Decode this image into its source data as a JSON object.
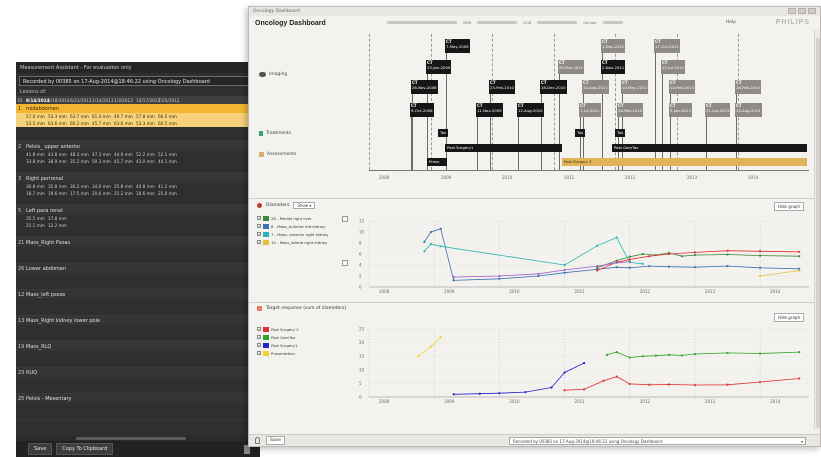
{
  "measurement": {
    "title": "Measurement Assistant - For evaluation only",
    "recorded": "Recorded by 00385 on 17-Aug-2014@18:46:22 using Oncology Dashboard",
    "lesions_of": "Lesions of:",
    "headers": [
      "ID",
      "8/14/2014",
      "2/18/2014",
      "6/21/2013",
      "2/14/2013",
      "1/3/2013",
      "10/17/2012",
      "7/25/2012"
    ],
    "lesions": [
      {
        "num": "1",
        "label": "midabdomen",
        "selected": true,
        "rows": [
          [
            "57.0 mm",
            "53.3 mm",
            "63.7 mm",
            "61.4 mm",
            "49.7 mm",
            "57.8 mm",
            "66.5 mm"
          ],
          [
            "53.5 mm",
            "63.6 mm",
            "60.2 mm",
            "45.7 mm",
            "63.6 mm",
            "53.3 mm",
            "60.5 mm"
          ]
        ]
      },
      {
        "num": "2",
        "label": "Pelvis_ upper anterior",
        "selected": false,
        "rows": [
          [
            "41.8 mm",
            "43.8 mm",
            "48.3 mm",
            "47.3 mm",
            "44.9 mm",
            "52.2 mm",
            "52.1 mm"
          ],
          [
            "33.8 mm",
            "38.9 mm",
            "35.2 mm",
            "50.3 mm",
            "45.7 mm",
            "43.0 mm",
            "44.1 mm"
          ]
        ]
      },
      {
        "num": "3",
        "label": "Right perirenal",
        "selected": false,
        "rows": [
          [
            "30.8 mm",
            "35.8 mm",
            "36.2 mm",
            "34.6 mm",
            "25.8 mm",
            "40.8 mm",
            "41.2 mm"
          ],
          [
            "18.7 mm",
            "19.6 mm",
            "17.5 mm",
            "20.6 mm",
            "21.2 mm",
            "18.6 mm",
            "25.0 mm"
          ]
        ]
      },
      {
        "num": "5",
        "label": "Left para renal",
        "selected": false,
        "rows": [
          [
            "35.5 mm",
            "17.8 mm"
          ],
          [
            "21.1 mm",
            "12.2 mm"
          ]
        ]
      },
      {
        "num": "21",
        "label": "Mass_Right Psoas",
        "selected": false,
        "rows": []
      },
      {
        "num": "26",
        "label": "Lower abdomen",
        "selected": false,
        "rows": []
      },
      {
        "num": "12",
        "label": "Mass_left psoas",
        "selected": false,
        "rows": []
      },
      {
        "num": "13",
        "label": "Mass_Right kidney lower pole",
        "selected": false,
        "rows": []
      },
      {
        "num": "19",
        "label": "Mass_RLQ",
        "selected": false,
        "rows": []
      },
      {
        "num": "23",
        "label": "RUQ",
        "selected": false,
        "rows": []
      },
      {
        "num": "25",
        "label": "Pelvis - Mesentary",
        "selected": false,
        "rows": []
      }
    ],
    "save_label": "Save",
    "clipboard_label": "Copy To Clipboard"
  },
  "dashboard": {
    "window_title": "Oncology Dashboard",
    "app_title": "Oncology Dashboard",
    "mrn_label": "MRN",
    "dob_label": "DOB",
    "gender_label": "Gender",
    "help": "Help",
    "logo": "PHILIPS",
    "rows": {
      "imaging": "Imaging",
      "treatments": "Treatments",
      "assessments": "Assessments"
    },
    "ct_events": [
      {
        "mod": "CT",
        "date": "7-May-2009",
        "grey": false
      },
      {
        "mod": "CT",
        "date": "1-Dec-2011",
        "grey": true
      },
      {
        "mod": "CT",
        "date": "17-Oct-2012",
        "grey": true
      },
      {
        "mod": "CT",
        "date": "23-Jan-2009",
        "grey": false
      },
      {
        "mod": "CT",
        "date": "25-Mar-2011",
        "grey": true
      },
      {
        "mod": "CT",
        "date": "2-Nov-2011",
        "grey": false
      },
      {
        "mod": "CT",
        "date": "25-Jul-2012",
        "grey": true
      },
      {
        "mod": "CT",
        "date": "26-Nov-2008",
        "grey": false
      },
      {
        "mod": "CT",
        "date": "23-Feb-2010",
        "grey": false
      },
      {
        "mod": "CT",
        "date": "18-Dec-2010",
        "grey": false
      },
      {
        "mod": "CT",
        "date": "15-Aug-2011",
        "grey": true
      },
      {
        "mod": "CT",
        "date": "10-May-2012",
        "grey": true
      },
      {
        "mod": "CT",
        "date": "14-Feb-2013",
        "grey": true
      },
      {
        "mod": "CT",
        "date": "18-Feb-2014",
        "grey": true
      },
      {
        "mod": "CT",
        "date": "9-Oct-2008",
        "grey": false
      },
      {
        "mod": "CT",
        "date": "11-Nov-2009",
        "grey": false
      },
      {
        "mod": "CT",
        "date": "12-Aug-2010",
        "grey": false
      },
      {
        "mod": "CT",
        "date": "7-Jul-2011",
        "grey": true
      },
      {
        "mod": "CT",
        "date": "16-Mar-2012",
        "grey": true
      },
      {
        "mod": "CT",
        "date": "3-Jan-2013",
        "grey": true
      },
      {
        "mod": "CT",
        "date": "21-Jun-2013",
        "grey": true
      },
      {
        "mod": "CT",
        "date": "14-Aug-2014",
        "grey": true
      }
    ],
    "treatments": [
      "Tax",
      "Tax",
      "Tax"
    ],
    "assessments": [
      "Post Surgery1",
      "Post GemTax",
      "Presn",
      "Post Surgery 2"
    ],
    "years": [
      "2008",
      "2009",
      "2010",
      "2011",
      "2012",
      "2013",
      "2014"
    ],
    "diameters_title": "Diameters",
    "show_label": "Show",
    "hide_graph": "Hide graph",
    "diam_legend": [
      {
        "label": "26 - Medial right liver",
        "color": "#3d8a3d"
      },
      {
        "label": "8 - Mass_Anterior left kidney",
        "color": "#3a6fb5"
      },
      {
        "label": "7 - Mass- anterior right kidney",
        "color": "#29b5b5"
      },
      {
        "label": "10 - Mass_lateral right kidney",
        "color": "#e0c23a"
      }
    ],
    "target_title": "Target response (sum of diameters)",
    "target_legend": [
      {
        "label": "Post Surgery 2",
        "color": "#e03030"
      },
      {
        "label": "Post GemTax",
        "color": "#2aa52a"
      },
      {
        "label": "Post Surgery1",
        "color": "#2525c8"
      },
      {
        "label": "Presentation",
        "color": "#f2d22a"
      }
    ],
    "save_label": "Save",
    "recorded": "Recorded by 00385 on 17-Aug-2014@18:46:22 using Oncology Dashboard"
  },
  "chart_data": [
    {
      "type": "line",
      "title": "Diameters",
      "xlim": [
        2008.0,
        2014.75
      ],
      "ylim": [
        0,
        12
      ],
      "yticks": [
        0,
        2,
        4,
        6,
        8,
        10,
        12
      ],
      "series": [
        {
          "name": "26 - Medial right liver",
          "color": "#3d8a3d",
          "x": [
            2011.5,
            2011.8,
            2012.0,
            2012.2,
            2012.4,
            2012.6,
            2012.8,
            2013.0,
            2013.5,
            2014.0,
            2014.6
          ],
          "y": [
            3.5,
            4.8,
            5.5,
            6.0,
            5.8,
            6.2,
            5.6,
            5.8,
            5.9,
            5.7,
            5.6
          ]
        },
        {
          "name": "8 - Mass_Anterior left kidney",
          "color": "#3a6fb5",
          "x": [
            2008.85,
            2008.95,
            2009.1,
            2009.3,
            2010.0,
            2010.6,
            2011.0,
            2011.5,
            2011.8,
            2012.0,
            2012.3,
            2012.6,
            2013.0,
            2013.5,
            2014.0,
            2014.6
          ],
          "y": [
            8.2,
            10.0,
            10.6,
            1.2,
            1.5,
            2.0,
            2.6,
            3.2,
            3.6,
            3.5,
            3.8,
            3.7,
            3.6,
            3.8,
            3.5,
            3.3
          ]
        },
        {
          "name": "7 - Mass- anterior right kidney",
          "color": "#29b5b5",
          "x": [
            2008.85,
            2008.95,
            2009.1,
            2011.0,
            2011.5,
            2011.8,
            2012.0,
            2012.2
          ],
          "y": [
            6.5,
            7.8,
            7.4,
            4.0,
            7.5,
            9.0,
            4.5,
            4.2
          ]
        },
        {
          "name": "10 - Mass_lateral right kidney",
          "color": "#e0c23a",
          "x": [
            2014.0,
            2014.6
          ],
          "y": [
            2.0,
            3.0
          ]
        },
        {
          "name": "",
          "color": "#e03030",
          "x": [
            2011.5,
            2011.8,
            2012.0,
            2012.3,
            2012.6,
            2013.0,
            2013.5,
            2014.0,
            2014.6
          ],
          "y": [
            3.0,
            4.5,
            5.0,
            5.6,
            6.0,
            6.3,
            6.6,
            6.5,
            6.4
          ]
        },
        {
          "name": "",
          "color": "#9a5fcf",
          "x": [
            2009.3,
            2010.0,
            2010.6,
            2011.0,
            2011.5,
            2011.8,
            2012.0
          ],
          "y": [
            1.8,
            2.0,
            2.4,
            3.1,
            3.8,
            4.4,
            4.6
          ]
        }
      ]
    },
    {
      "type": "line",
      "title": "Target response (sum of diameters)",
      "xlim": [
        2008.0,
        2014.75
      ],
      "ylim": [
        0,
        25
      ],
      "yticks": [
        0,
        5,
        10,
        15,
        20,
        25
      ],
      "series": [
        {
          "name": "Post Surgery 2",
          "color": "#e03030",
          "x": [
            2011.0,
            2011.3,
            2011.6,
            2011.8,
            2012.0,
            2012.3,
            2012.6,
            2013.0,
            2013.5,
            2014.0,
            2014.6
          ],
          "y": [
            2.5,
            2.8,
            6.0,
            7.5,
            4.8,
            4.5,
            4.6,
            4.4,
            4.5,
            5.5,
            6.8
          ]
        },
        {
          "name": "Post GemTax",
          "color": "#2aa52a",
          "x": [
            2011.65,
            2011.8,
            2012.0,
            2012.2,
            2012.4,
            2012.6,
            2012.8,
            2013.0,
            2013.5,
            2014.0,
            2014.6
          ],
          "y": [
            15.5,
            16.5,
            14.5,
            15.0,
            15.2,
            15.5,
            15.3,
            15.8,
            16.2,
            16.0,
            16.5
          ]
        },
        {
          "name": "Post Surgery1",
          "color": "#2525c8",
          "x": [
            2009.3,
            2009.7,
            2010.0,
            2010.4,
            2010.8,
            2011.0,
            2011.3
          ],
          "y": [
            1.0,
            1.2,
            1.4,
            1.8,
            3.5,
            9.0,
            12.5
          ]
        },
        {
          "name": "Presentation",
          "color": "#f2d22a",
          "x": [
            2008.75,
            2008.95,
            2009.1
          ],
          "y": [
            15.0,
            18.5,
            22.0
          ]
        }
      ]
    }
  ]
}
